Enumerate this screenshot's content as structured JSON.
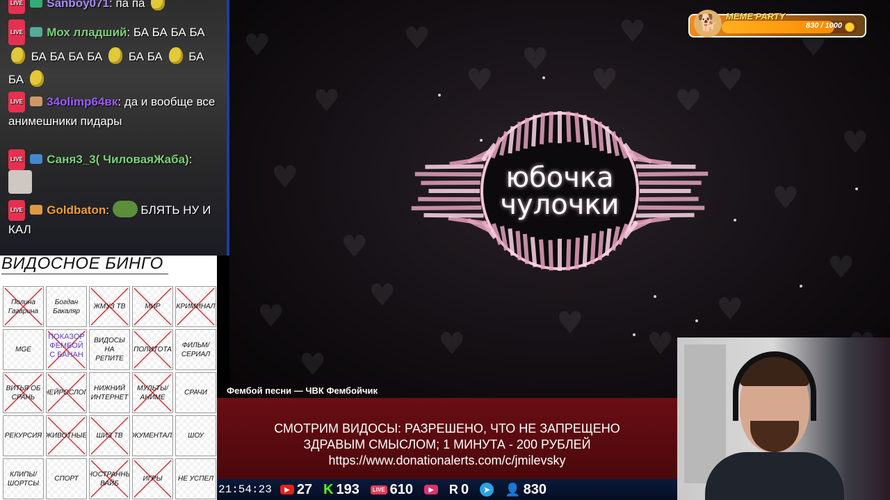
{
  "chat": {
    "messages": [
      {
        "nick": "Sanboy071",
        "text": "па па",
        "color": "#a78bfa"
      },
      {
        "nick": "Мох лладший",
        "text_parts": [
          "БА БА БА",
          "БА",
          "БА БА БА БА",
          "БА БА",
          "БА БА",
          "БА БА БА БА"
        ],
        "color": "#7cd17c"
      },
      {
        "nick": "34olimp64вк",
        "text": "да и вообще все анимешники пидары",
        "color": "#9b59ff"
      },
      {
        "nick": "Саня3_3( ЧиловаяЖаба)",
        "text": "",
        "color": "#7cd17c"
      },
      {
        "nick": "Goldbaton",
        "text": "БЛЯТЬ НУ И КАЛ",
        "color": "#f0a030"
      }
    ],
    "live_label": "LIVE"
  },
  "bingo": {
    "title": "ВИДОСНОЕ БИНГО",
    "cells": [
      {
        "label": "Полина Гагарина",
        "crossed": true
      },
      {
        "label": "Богдан Бакаляр",
        "crossed": false
      },
      {
        "label": "ЖМУЗ ТВ",
        "crossed": true
      },
      {
        "label": "МИР",
        "crossed": true
      },
      {
        "label": "КРИМИНАЛ",
        "crossed": true
      },
      {
        "label": "MGE",
        "crossed": false
      },
      {
        "label": "ФЕМБОЙ",
        "crossed": true,
        "handwritten": "ПОКАЗОР ФЕМБОЙ С БАНАН"
      },
      {
        "label": "ВИДОСЫ НА РЕПИТЕ",
        "crossed": false
      },
      {
        "label": "ПОЛИТОТА",
        "crossed": true
      },
      {
        "label": "ФИЛЬМ/ СЕРИАЛ",
        "crossed": false
      },
      {
        "label": "ВИТЬЯ ОБ СРАНЬ",
        "crossed": true
      },
      {
        "label": "НЕЙРОСЛОП",
        "crossed": true
      },
      {
        "label": "НИЖНИЙ ИНТЕРНЕТ",
        "crossed": false
      },
      {
        "label": "МУЛЬТЫ/ АНИМЕ",
        "crossed": true
      },
      {
        "label": "СРАЧИ",
        "crossed": false
      },
      {
        "label": "РЕКУРСИЯ",
        "crossed": false
      },
      {
        "label": "ЖИВОТНЫЕ",
        "crossed": true
      },
      {
        "label": "ШИЗ ТВ",
        "crossed": true
      },
      {
        "label": "ДОКУМЕНТАЛКИ",
        "crossed": false
      },
      {
        "label": "ШОУ",
        "crossed": false
      },
      {
        "label": "КЛИПЫ/ ШОРТСЫ",
        "crossed": false
      },
      {
        "label": "СПОРТ",
        "crossed": false
      },
      {
        "label": "ИНОСТРАННЫЙ ВАЙБ",
        "crossed": true
      },
      {
        "label": "ИГРЫ",
        "crossed": true
      },
      {
        "label": "НЕ УСПЕЛ",
        "crossed": false
      }
    ]
  },
  "video": {
    "song_line1": "юбочка",
    "song_line2": "чулочки",
    "caption": "Фембой песни — ЧВК Фембойчик"
  },
  "banner": {
    "line1": "СМОТРИМ ВИДОСЫ: РАЗРЕШЕНО, ЧТО НЕ ЗАПРЕЩЕНО",
    "line2": "ЗДРАВЫМ СМЫСЛОМ; 1 МИНУТА - 200 РУБЛЕЙ",
    "line3": "https://www.donationalerts.com/c/jmilevsky"
  },
  "status": {
    "clock": "21:54:23",
    "youtube_count": "27",
    "kick_count": "193",
    "vk_live_count": "610",
    "rutube_count": "0",
    "total_viewers": "830"
  },
  "meme_party": {
    "title": "MEME PARTY",
    "value": "830 / 1000",
    "progress": 0.83
  },
  "colors": {
    "banner_red": "#5a0b10",
    "statusbar_blue": "#0a1a3a",
    "kick_green": "#53fc18",
    "youtube_red": "#e62117",
    "crossout_red": "#d0343a"
  }
}
